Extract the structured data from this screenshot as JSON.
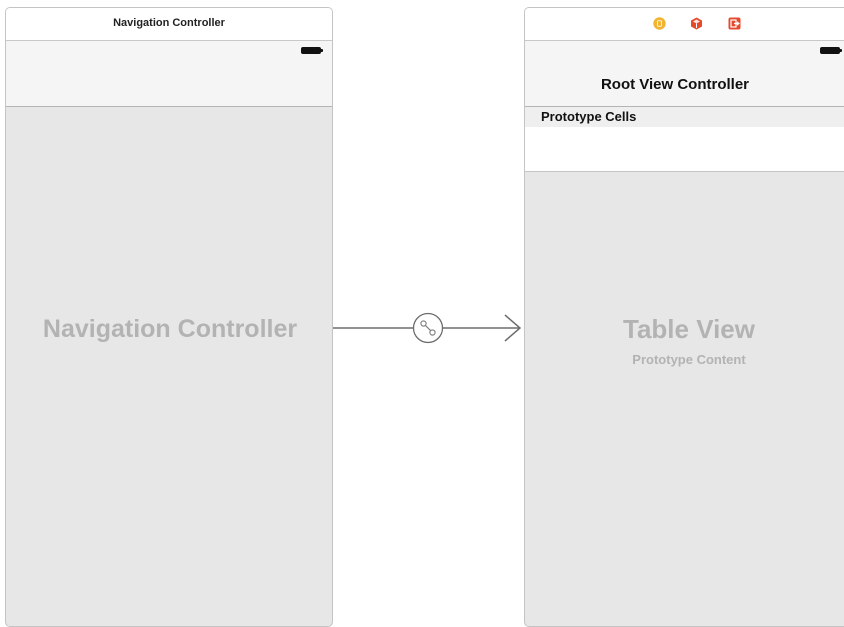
{
  "nav_scene": {
    "title": "Navigation Controller",
    "main_label": "Navigation Controller",
    "battery_icon": "battery-icon"
  },
  "root_scene": {
    "dock_icons": [
      "view-controller-icon",
      "first-responder-icon",
      "exit-icon"
    ],
    "nav_title": "Root View Controller",
    "section_header": "Prototype Cells",
    "table_view_label": "Table View",
    "prototype_content_label": "Prototype Content",
    "battery_icon": "battery-icon"
  },
  "segue": {
    "icon": "relationship-segue-icon"
  },
  "colors": {
    "dock_yellow": "#f1b531",
    "dock_red": "#e8492b",
    "dock_exit": "#e44a2e",
    "placeholder_text": "#b3b3b3",
    "segue_line": "#6d6d6d"
  }
}
